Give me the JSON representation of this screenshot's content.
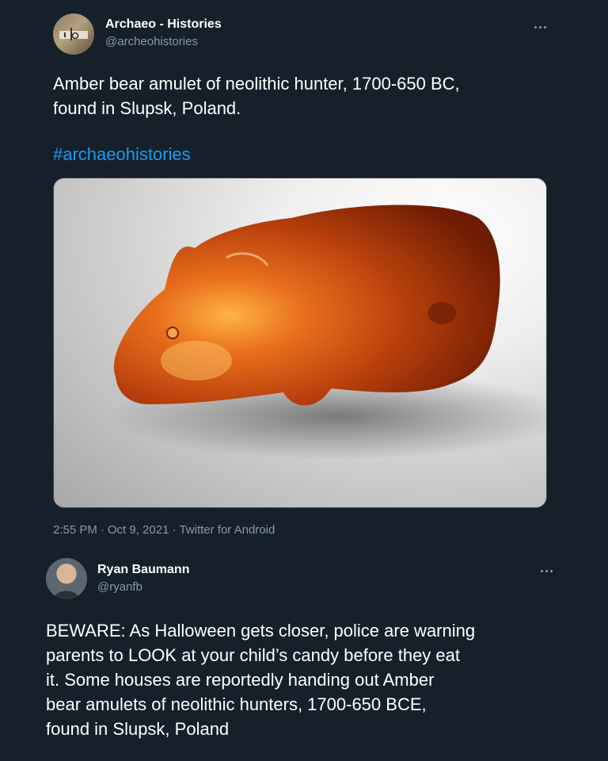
{
  "tweets": [
    {
      "author": {
        "name": "Archaeo - Histories",
        "handle": "@archeohistories",
        "avatar_icon": "archaeo-logo-avatar"
      },
      "text": "Amber bear amulet of neolithic hunter, 1700-650 BC,\nfound in Slupsk, Poland.",
      "hashtag": "#archaeohistories",
      "media_icon": "amber-bear-photo",
      "meta": {
        "time": "2:55 PM",
        "date": "Oct 9, 2021",
        "source": "Twitter for Android"
      }
    },
    {
      "author": {
        "name": "Ryan Baumann",
        "handle": "@ryanfb",
        "avatar_icon": "user-portrait-avatar"
      },
      "text": "BEWARE: As Halloween gets closer, police are warning\nparents to LOOK at your child’s candy before they eat\nit. Some houses are reportedly handing out Amber\nbear amulets of neolithic hunters, 1700-650 BCE,\nfound in Slupsk, Poland"
    }
  ],
  "colors": {
    "background": "#15202b",
    "text": "#ffffff",
    "secondary_text": "#8899a6",
    "link": "#1d9bf0",
    "amber": "#c8470c"
  }
}
